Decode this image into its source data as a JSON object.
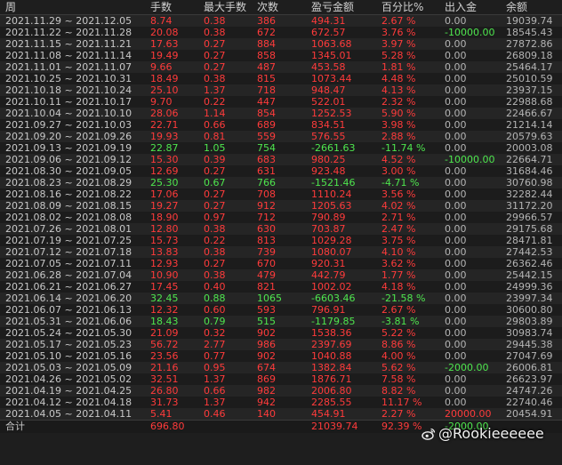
{
  "headers": [
    "周",
    "手数",
    "最大手数",
    "次数",
    "盈亏金额",
    "百分比%",
    "出入金",
    "余额"
  ],
  "rows": [
    {
      "week": "2021.11.29 ~ 2021.12.05",
      "lots": "8.74",
      "max_lots": "0.38",
      "count": "386",
      "pnl": "494.31",
      "pct": "2.67 %",
      "flow": "0.00",
      "balance": "19039.74",
      "sign": "pos",
      "flow_sign": ""
    },
    {
      "week": "2021.11.22 ~ 2021.11.28",
      "lots": "20.08",
      "max_lots": "0.38",
      "count": "672",
      "pnl": "672.57",
      "pct": "3.76 %",
      "flow": "-10000.00",
      "balance": "18545.43",
      "sign": "pos",
      "flow_sign": "neg"
    },
    {
      "week": "2021.11.15 ~ 2021.11.21",
      "lots": "17.63",
      "max_lots": "0.27",
      "count": "884",
      "pnl": "1063.68",
      "pct": "3.97 %",
      "flow": "0.00",
      "balance": "27872.86",
      "sign": "pos",
      "flow_sign": ""
    },
    {
      "week": "2021.11.08 ~ 2021.11.14",
      "lots": "19.49",
      "max_lots": "0.27",
      "count": "858",
      "pnl": "1345.01",
      "pct": "5.28 %",
      "flow": "0.00",
      "balance": "26809.18",
      "sign": "pos",
      "flow_sign": ""
    },
    {
      "week": "2021.11.01 ~ 2021.11.07",
      "lots": "9.66",
      "max_lots": "0.27",
      "count": "487",
      "pnl": "453.58",
      "pct": "1.81 %",
      "flow": "0.00",
      "balance": "25464.17",
      "sign": "pos",
      "flow_sign": ""
    },
    {
      "week": "2021.10.25 ~ 2021.10.31",
      "lots": "18.49",
      "max_lots": "0.38",
      "count": "815",
      "pnl": "1073.44",
      "pct": "4.48 %",
      "flow": "0.00",
      "balance": "25010.59",
      "sign": "pos",
      "flow_sign": ""
    },
    {
      "week": "2021.10.18 ~ 2021.10.24",
      "lots": "25.10",
      "max_lots": "1.37",
      "count": "718",
      "pnl": "948.47",
      "pct": "4.13 %",
      "flow": "0.00",
      "balance": "23937.15",
      "sign": "pos",
      "flow_sign": ""
    },
    {
      "week": "2021.10.11 ~ 2021.10.17",
      "lots": "9.70",
      "max_lots": "0.22",
      "count": "447",
      "pnl": "522.01",
      "pct": "2.32 %",
      "flow": "0.00",
      "balance": "22988.68",
      "sign": "pos",
      "flow_sign": ""
    },
    {
      "week": "2021.10.04 ~ 2021.10.10",
      "lots": "28.06",
      "max_lots": "1.14",
      "count": "854",
      "pnl": "1252.53",
      "pct": "5.90 %",
      "flow": "0.00",
      "balance": "22466.67",
      "sign": "pos",
      "flow_sign": ""
    },
    {
      "week": "2021.09.27 ~ 2021.10.03",
      "lots": "22.71",
      "max_lots": "0.66",
      "count": "689",
      "pnl": "834.51",
      "pct": "3.98 %",
      "flow": "0.00",
      "balance": "21214.14",
      "sign": "pos",
      "flow_sign": ""
    },
    {
      "week": "2021.09.20 ~ 2021.09.26",
      "lots": "19.93",
      "max_lots": "0.81",
      "count": "559",
      "pnl": "576.55",
      "pct": "2.88 %",
      "flow": "0.00",
      "balance": "20579.63",
      "sign": "pos",
      "flow_sign": ""
    },
    {
      "week": "2021.09.13 ~ 2021.09.19",
      "lots": "22.87",
      "max_lots": "1.05",
      "count": "754",
      "pnl": "-2661.63",
      "pct": "-11.74 %",
      "flow": "0.00",
      "balance": "20003.08",
      "sign": "neg",
      "flow_sign": ""
    },
    {
      "week": "2021.09.06 ~ 2021.09.12",
      "lots": "15.30",
      "max_lots": "0.39",
      "count": "683",
      "pnl": "980.25",
      "pct": "4.52 %",
      "flow": "-10000.00",
      "balance": "22664.71",
      "sign": "pos",
      "flow_sign": "neg"
    },
    {
      "week": "2021.08.30 ~ 2021.09.05",
      "lots": "12.69",
      "max_lots": "0.27",
      "count": "631",
      "pnl": "923.48",
      "pct": "3.00 %",
      "flow": "0.00",
      "balance": "31684.46",
      "sign": "pos",
      "flow_sign": ""
    },
    {
      "week": "2021.08.23 ~ 2021.08.29",
      "lots": "25.30",
      "max_lots": "0.67",
      "count": "766",
      "pnl": "-1521.46",
      "pct": "-4.71 %",
      "flow": "0.00",
      "balance": "30760.98",
      "sign": "neg",
      "flow_sign": ""
    },
    {
      "week": "2021.08.16 ~ 2021.08.22",
      "lots": "17.06",
      "max_lots": "0.27",
      "count": "708",
      "pnl": "1110.24",
      "pct": "3.56 %",
      "flow": "0.00",
      "balance": "32282.44",
      "sign": "pos",
      "flow_sign": ""
    },
    {
      "week": "2021.08.09 ~ 2021.08.15",
      "lots": "19.27",
      "max_lots": "0.27",
      "count": "912",
      "pnl": "1205.63",
      "pct": "4.02 %",
      "flow": "0.00",
      "balance": "31172.20",
      "sign": "pos",
      "flow_sign": ""
    },
    {
      "week": "2021.08.02 ~ 2021.08.08",
      "lots": "18.90",
      "max_lots": "0.97",
      "count": "712",
      "pnl": "790.89",
      "pct": "2.71 %",
      "flow": "0.00",
      "balance": "29966.57",
      "sign": "pos",
      "flow_sign": ""
    },
    {
      "week": "2021.07.26 ~ 2021.08.01",
      "lots": "12.80",
      "max_lots": "0.38",
      "count": "630",
      "pnl": "703.87",
      "pct": "2.47 %",
      "flow": "0.00",
      "balance": "29175.68",
      "sign": "pos",
      "flow_sign": ""
    },
    {
      "week": "2021.07.19 ~ 2021.07.25",
      "lots": "15.73",
      "max_lots": "0.22",
      "count": "813",
      "pnl": "1029.28",
      "pct": "3.75 %",
      "flow": "0.00",
      "balance": "28471.81",
      "sign": "pos",
      "flow_sign": ""
    },
    {
      "week": "2021.07.12 ~ 2021.07.18",
      "lots": "13.83",
      "max_lots": "0.38",
      "count": "739",
      "pnl": "1080.07",
      "pct": "4.10 %",
      "flow": "0.00",
      "balance": "27442.53",
      "sign": "pos",
      "flow_sign": ""
    },
    {
      "week": "2021.07.05 ~ 2021.07.11",
      "lots": "12.93",
      "max_lots": "0.27",
      "count": "670",
      "pnl": "920.31",
      "pct": "3.62 %",
      "flow": "0.00",
      "balance": "26362.46",
      "sign": "pos",
      "flow_sign": ""
    },
    {
      "week": "2021.06.28 ~ 2021.07.04",
      "lots": "10.90",
      "max_lots": "0.38",
      "count": "479",
      "pnl": "442.79",
      "pct": "1.77 %",
      "flow": "0.00",
      "balance": "25442.15",
      "sign": "pos",
      "flow_sign": ""
    },
    {
      "week": "2021.06.21 ~ 2021.06.27",
      "lots": "17.45",
      "max_lots": "0.40",
      "count": "821",
      "pnl": "1002.02",
      "pct": "4.18 %",
      "flow": "0.00",
      "balance": "24999.36",
      "sign": "pos",
      "flow_sign": ""
    },
    {
      "week": "2021.06.14 ~ 2021.06.20",
      "lots": "32.45",
      "max_lots": "0.88",
      "count": "1065",
      "pnl": "-6603.46",
      "pct": "-21.58 %",
      "flow": "0.00",
      "balance": "23997.34",
      "sign": "neg",
      "flow_sign": ""
    },
    {
      "week": "2021.06.07 ~ 2021.06.13",
      "lots": "12.32",
      "max_lots": "0.60",
      "count": "593",
      "pnl": "796.91",
      "pct": "2.67 %",
      "flow": "0.00",
      "balance": "30600.80",
      "sign": "pos",
      "flow_sign": ""
    },
    {
      "week": "2021.05.31 ~ 2021.06.06",
      "lots": "18.43",
      "max_lots": "0.79",
      "count": "515",
      "pnl": "-1179.85",
      "pct": "-3.81 %",
      "flow": "0.00",
      "balance": "29803.89",
      "sign": "neg",
      "flow_sign": ""
    },
    {
      "week": "2021.05.24 ~ 2021.05.30",
      "lots": "21.09",
      "max_lots": "0.32",
      "count": "902",
      "pnl": "1538.36",
      "pct": "5.22 %",
      "flow": "0.00",
      "balance": "30983.74",
      "sign": "pos",
      "flow_sign": ""
    },
    {
      "week": "2021.05.17 ~ 2021.05.23",
      "lots": "56.72",
      "max_lots": "2.77",
      "count": "986",
      "pnl": "2397.69",
      "pct": "8.86 %",
      "flow": "0.00",
      "balance": "29445.38",
      "sign": "pos",
      "flow_sign": ""
    },
    {
      "week": "2021.05.10 ~ 2021.05.16",
      "lots": "23.56",
      "max_lots": "0.77",
      "count": "902",
      "pnl": "1040.88",
      "pct": "4.00 %",
      "flow": "0.00",
      "balance": "27047.69",
      "sign": "pos",
      "flow_sign": ""
    },
    {
      "week": "2021.05.03 ~ 2021.05.09",
      "lots": "21.16",
      "max_lots": "0.95",
      "count": "674",
      "pnl": "1382.84",
      "pct": "5.62 %",
      "flow": "-2000.00",
      "balance": "26006.81",
      "sign": "pos",
      "flow_sign": "neg"
    },
    {
      "week": "2021.04.26 ~ 2021.05.02",
      "lots": "32.51",
      "max_lots": "1.37",
      "count": "869",
      "pnl": "1876.71",
      "pct": "7.58 %",
      "flow": "0.00",
      "balance": "26623.97",
      "sign": "pos",
      "flow_sign": ""
    },
    {
      "week": "2021.04.19 ~ 2021.04.25",
      "lots": "26.80",
      "max_lots": "0.66",
      "count": "982",
      "pnl": "2006.80",
      "pct": "8.82 %",
      "flow": "0.00",
      "balance": "24747.26",
      "sign": "pos",
      "flow_sign": ""
    },
    {
      "week": "2021.04.12 ~ 2021.04.18",
      "lots": "31.73",
      "max_lots": "1.37",
      "count": "942",
      "pnl": "2285.55",
      "pct": "11.17 %",
      "flow": "0.00",
      "balance": "22740.46",
      "sign": "pos",
      "flow_sign": ""
    },
    {
      "week": "2021.04.05 ~ 2021.04.11",
      "lots": "5.41",
      "max_lots": "0.46",
      "count": "140",
      "pnl": "454.91",
      "pct": "2.27 %",
      "flow": "20000.00",
      "balance": "20454.91",
      "sign": "pos",
      "flow_sign": "pos"
    }
  ],
  "total": {
    "label": "合计",
    "lots": "696.80",
    "max_lots": "",
    "count": "",
    "pnl": "21039.74",
    "pct": "92.39 %",
    "flow": "-2000.00",
    "balance": ""
  },
  "watermark": {
    "text": "@Rookieeeeee",
    "icon": "weibo-icon"
  },
  "colors": {
    "background": "#1e1e1e",
    "positive": "#ff3b3b",
    "negative": "#4ee64e",
    "text": "#c8c8c8"
  }
}
